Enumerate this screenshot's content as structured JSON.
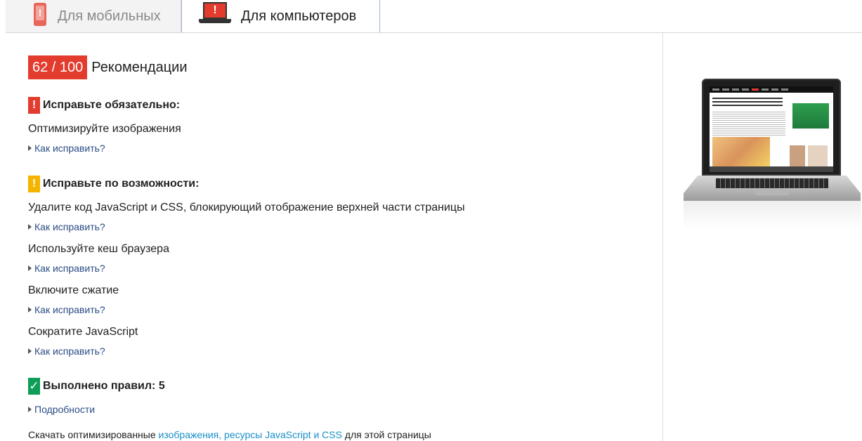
{
  "tabs": {
    "mobile_label": "Для мобильных",
    "desktop_label": "Для компьютеров"
  },
  "score": {
    "value": "62 / 100",
    "title": "Рекомендации"
  },
  "must_fix": {
    "title": "Исправьте обязательно:",
    "flag": "!",
    "items": [
      {
        "label": "Оптимизируйте изображения",
        "howto": "Как исправить?"
      }
    ]
  },
  "should_fix": {
    "title": "Исправьте по возможности:",
    "flag": "!",
    "items": [
      {
        "label": "Удалите код JavaScript и CSS, блокирующий отображение верхней части страницы",
        "howto": "Как исправить?"
      },
      {
        "label": "Используйте кеш браузера",
        "howto": "Как исправить?"
      },
      {
        "label": "Включите сжатие",
        "howto": "Как исправить?"
      },
      {
        "label": "Сократите JavaScript",
        "howto": "Как исправить?"
      }
    ]
  },
  "passed": {
    "title": "Выполнено правил: 5",
    "flag": "✓",
    "details": "Подробности"
  },
  "download": {
    "prefix": "Скачать оптимизированные ",
    "link": "изображения, ресурсы JavaScript и CSS",
    "suffix": " для этой страницы"
  },
  "icons": {
    "mobile_tab": "phone-warning-icon",
    "desktop_tab": "laptop-warning-icon",
    "expand": "caret-right-icon"
  },
  "colors": {
    "score_badge": "#e33b2e",
    "must_fix_flag": "#e33b2e",
    "should_fix_flag": "#f4b400",
    "passed_flag": "#0f9d58",
    "link": "#2a4c86",
    "download_link": "#1a8fc9"
  }
}
